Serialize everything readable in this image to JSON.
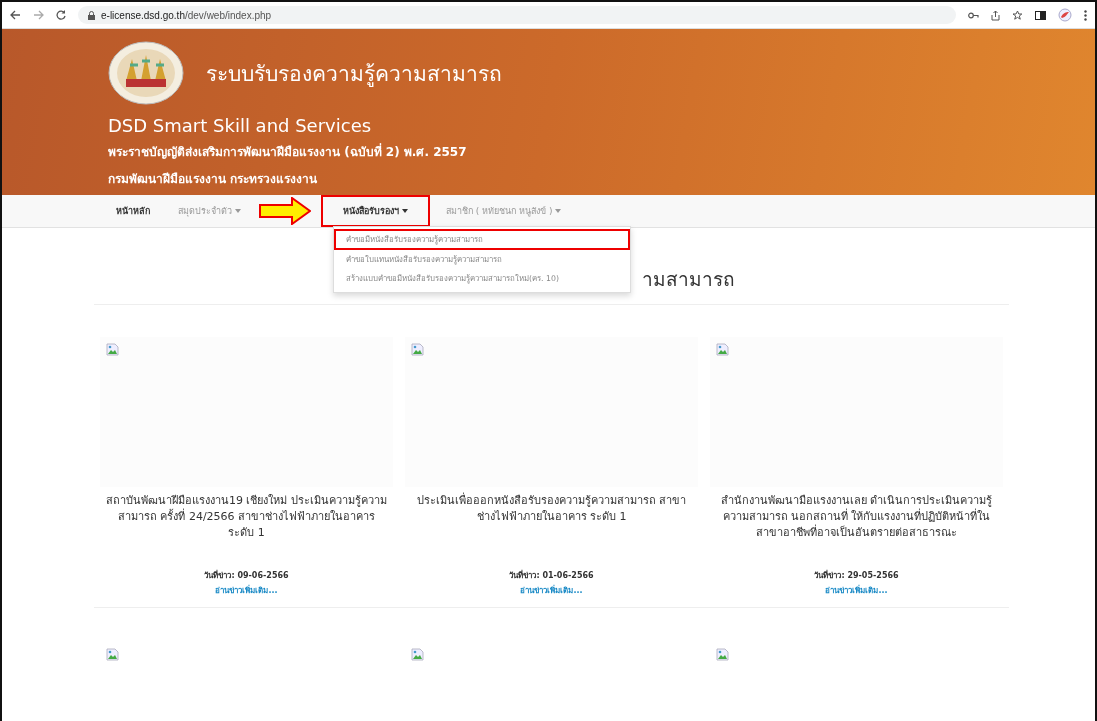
{
  "browser": {
    "url_host": "e-license.dsd.go.th",
    "url_path": "/dev/web/index.php"
  },
  "header": {
    "title": "ระบบรับรองความรู้ความสามารถ",
    "subtitle": "DSD Smart Skill and Services",
    "act": "พระราชบัญญัติส่งเสริมการพัฒนาฝีมือแรงงาน (ฉบับที่ 2) พ.ศ. 2557",
    "department": "กรมพัฒนาฝีมือแรงงาน กระทรวงแรงงาน"
  },
  "nav": [
    {
      "label": "หน้าหลัก",
      "dropdown": false,
      "emphasized": true,
      "annotated": false
    },
    {
      "label": "สมุดประจำตัว",
      "dropdown": true,
      "emphasized": false,
      "annotated": false
    },
    {
      "label": "หนังสือรับรองฯ",
      "dropdown": true,
      "emphasized": true,
      "annotated": true
    },
    {
      "label": "สมาชิก ( หทัยชนก หนูสังข์ )",
      "dropdown": true,
      "emphasized": false,
      "annotated": false
    }
  ],
  "dropdown": [
    {
      "label": "คำขอมีหนังสือรับรองความรู้ความสามารถ",
      "annotated": true
    },
    {
      "label": "คำขอใบแทนหนังสือรับรองความรู้ความสามารถ",
      "annotated": false
    },
    {
      "label": "สร้างแบบคำขอมีหนังสือรับรองความรู้ความสามารถใหม่(คร. 10)",
      "annotated": false
    }
  ],
  "heading": "ามสามารถ",
  "news": [
    {
      "title": "สถาบันพัฒนาฝีมือแรงงาน19 เชียงใหม่ ประเมินความรู้ความสามารถ ครั้งที่ 24/2566 สาขาช่างไฟฟ้าภายในอาคาร ระดับ 1",
      "date": "วันที่ข่าว: 09-06-2566",
      "link": "อ่านข่าวเพิ่มเติม..."
    },
    {
      "title": "ประเมินเพื่อออกหนังสือรับรองความรู้ความสามารถ สาขาช่างไฟฟ้าภายในอาคาร ระดับ 1",
      "date": "วันที่ข่าว: 01-06-2566",
      "link": "อ่านข่าวเพิ่มเติม..."
    },
    {
      "title": "สำนักงานพัฒนามือแรงงานเลย ดำเนินการประเมินความรู้ความสามารถ นอกสถานที่ ให้กับแรงงานที่ปฏิบัติหน้าที่ในสาขาอาชีพที่อาจเป็นอันตรายต่อสาธารณะ",
      "date": "วันที่ข่าว: 29-05-2566",
      "link": "อ่านข่าวเพิ่มเติม..."
    }
  ],
  "news_row_2": [
    {
      "kind": "broken-image"
    },
    {
      "kind": "broken-image"
    },
    {
      "kind": "broken-image"
    }
  ]
}
